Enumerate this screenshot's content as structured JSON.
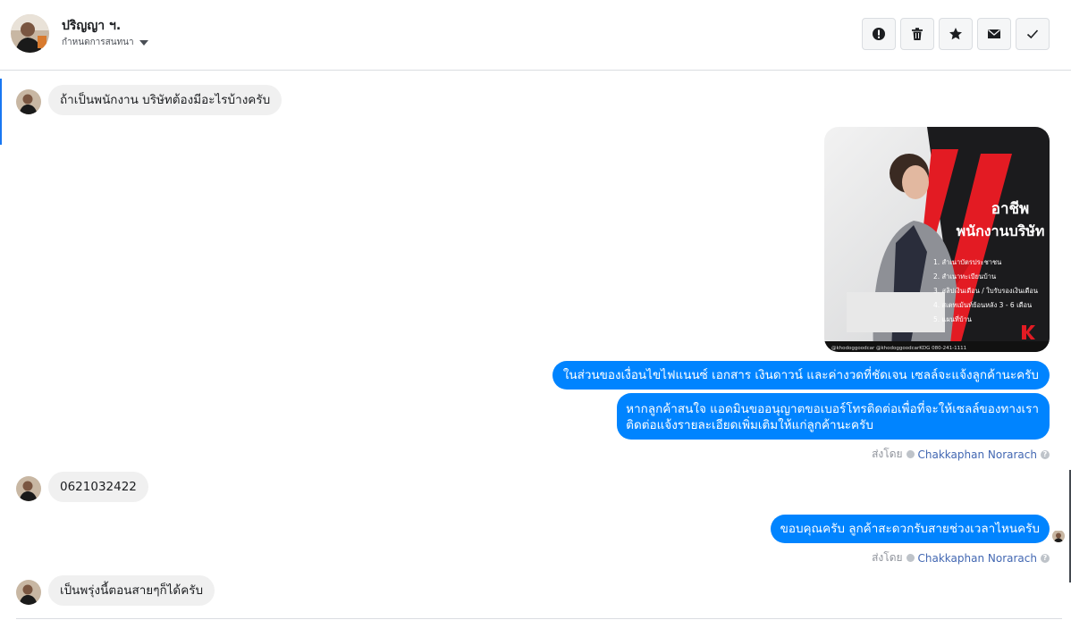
{
  "header": {
    "name": "ปริญญา ฯ.",
    "subtitle": "กำหนดการสนทนา",
    "actions": [
      {
        "icon": "alert-icon",
        "label": "Mark as spam"
      },
      {
        "icon": "trash-icon",
        "label": "Delete"
      },
      {
        "icon": "star-icon",
        "label": "Star"
      },
      {
        "icon": "envelope-icon",
        "label": "Mark as unread"
      },
      {
        "icon": "check-icon",
        "label": "Done"
      }
    ]
  },
  "messages": {
    "m1": "ถ้าเป็นพนักงาน บริษัทต้องมีอะไรบ้างครับ",
    "m2": "ในส่วนของเงื่อนไขไฟแนนซ์ เอกสาร เงินดาวน์ และค่างวดที่ชัดเจน เซลล์จะแจ้งลูกค้านะครับ",
    "m3_line1": "หากลูกค้าสนใจ แอดมินขออนุญาตขอเบอร์โทรติดต่อเพื่อที่จะให้เซลล์ของทางเรา",
    "m3_line2": "ติดต่อแจ้งรายละเอียดเพิ่มเติมให้แก่ลูกค้านะครับ",
    "m4": "0621032422",
    "m5": "ขอบคุณครับ ลูกค้าสะดวกรับสายช่วงเวลาไหนครับ",
    "m6": "เป็นพรุ่งนี้ตอนสายๆก็ได้ครับ"
  },
  "sent_by": {
    "prefix": "ส่งโดย",
    "agent": "Chakkaphan Norarach",
    "help": "?"
  },
  "media": {
    "title_line1": "อาชีพ",
    "title_line2": "พนักงานบริษัท",
    "items": [
      "1. สำเนาบัตรประชาชน",
      "2. สำเนาทะเบียนบ้าน",
      "3. สลิปเงินเดือน / ใบรับรองเงินเดือน",
      "4. สเตทเม้นท์ย้อนหลัง 3 - 6 เดือน",
      "5. แผนที่บ้าน"
    ],
    "footer": "@khodoggoodcar   @khodoggoodcarKDG   080-241-1111",
    "colors": {
      "accent": "#e31b23",
      "dark": "#1b1b1d",
      "bubble": "#0084ff"
    }
  }
}
